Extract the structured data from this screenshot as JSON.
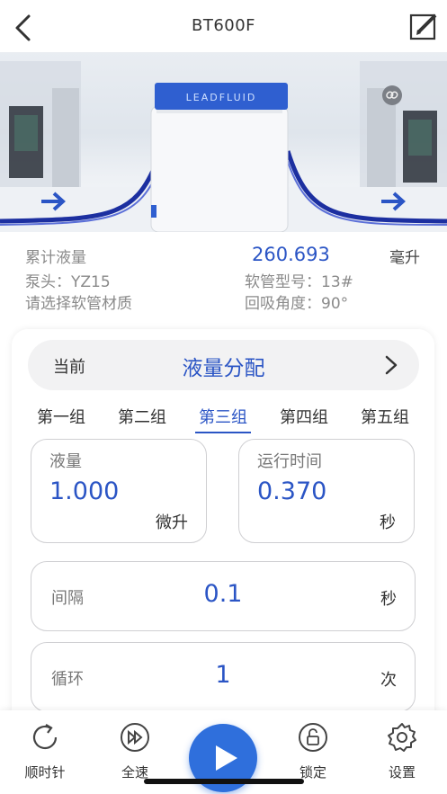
{
  "header": {
    "title": "BT600F",
    "back_icon": "chevron-left-icon",
    "edit_icon": "edit-icon"
  },
  "hero": {
    "brand": "LEADFLUID",
    "link_icon": "link-icon",
    "arrow_icon": "arrow-right-icon"
  },
  "info": {
    "total_label": "累计液量",
    "total_value": "260.693",
    "total_unit": "毫升",
    "pump_head": "泵头：YZ15",
    "tube_type": "软管型号：13#",
    "tube_material": "请选择软管材质",
    "suckback": "回吸角度：90°"
  },
  "mode": {
    "current_label": "当前",
    "current_value": "液量分配"
  },
  "tabs": [
    {
      "label": "第一组",
      "active": false
    },
    {
      "label": "第二组",
      "active": false
    },
    {
      "label": "第三组",
      "active": true
    },
    {
      "label": "第四组",
      "active": false
    },
    {
      "label": "第五组",
      "active": false
    }
  ],
  "volume": {
    "label": "液量",
    "value": "1.000",
    "unit": "微升"
  },
  "runtime": {
    "label": "运行时间",
    "value": "0.370",
    "unit": "秒"
  },
  "interval": {
    "label": "间隔",
    "value": "0.1",
    "unit": "秒"
  },
  "cycle": {
    "label": "循环",
    "value": "1",
    "unit": "次"
  },
  "bottom": {
    "clockwise": "顺时针",
    "full_speed": "全速",
    "lock": "锁定",
    "settings": "设置"
  },
  "colors": {
    "accent": "#2b55c5",
    "play": "#2f6fdc"
  }
}
